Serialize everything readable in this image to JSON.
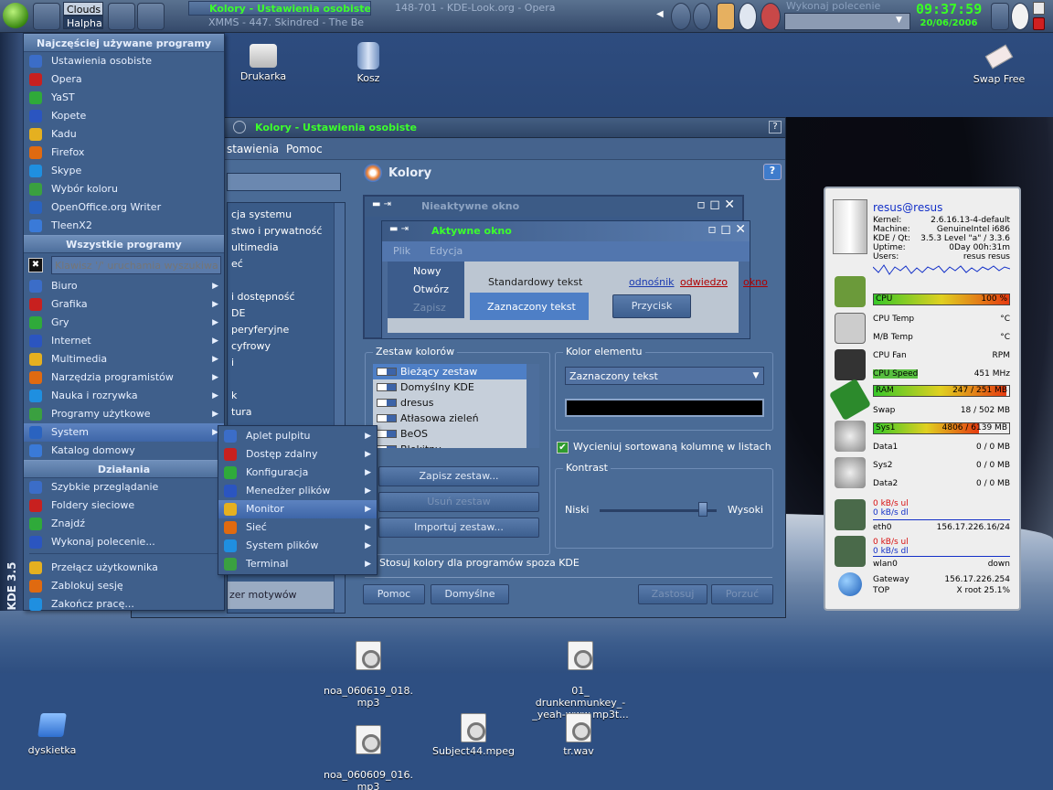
{
  "taskbar": {
    "desktops": [
      "Clouds",
      "Halpha"
    ],
    "tasks": [
      "Kolory - Ustawienia osobiste",
      "XMMS - 447. Skindred - The Be",
      "148-701 - KDE-Look.org - Opera"
    ],
    "run_label": "Wykonaj polecenie",
    "clock_time": "09:37:59",
    "clock_date": "20/06/2006"
  },
  "desktop": {
    "icons": [
      {
        "name": "printer-icon",
        "label": "Drukarka"
      },
      {
        "name": "trash-icon",
        "label": "Kosz"
      },
      {
        "name": "swap-icon",
        "label": "Swap Free"
      },
      {
        "name": "floppy-icon",
        "label": "dyskietka"
      },
      {
        "name": "mp3-icon",
        "label": "noa_060619_018.\nmp3"
      },
      {
        "name": "mp3-icon",
        "label": "01_\ndrunkenmunkey_-\n_yeah-www.mp3t..."
      },
      {
        "name": "mp3-icon",
        "label": "noa_060609_016.\nmp3"
      },
      {
        "name": "video-icon",
        "label": "Subject44.mpeg"
      },
      {
        "name": "wav-icon",
        "label": "tr.wav"
      }
    ]
  },
  "kmenu": {
    "vertical_label": "KDE 3.5",
    "sec_frequent": "Najczęściej używane programy",
    "frequent": [
      "Ustawienia osobiste",
      "Opera",
      "YaST",
      "Kopete",
      "Kadu",
      "Firefox",
      "Skype",
      "Wybór koloru",
      "OpenOffice.org Writer",
      "TleenX2"
    ],
    "sec_all": "Wszystkie programy",
    "search_placeholder": "Klawisz '/' uruchamia wyszukiwa",
    "all": [
      "Biuro",
      "Grafika",
      "Gry",
      "Internet",
      "Multimedia",
      "Narzędzia programistów",
      "Nauka i rozrywka",
      "Programy użytkowe",
      "System",
      "Katalog domowy"
    ],
    "sec_actions": "Działania",
    "actions": [
      "Szybkie przeglądanie",
      "Foldery sieciowe",
      "Znajdź",
      "Wykonaj polecenie...",
      "Przełącz użytkownika",
      "Zablokuj sesję",
      "Zakończ pracę..."
    ]
  },
  "submenu": [
    "Aplet pulpitu",
    "Dostęp zdalny",
    "Konfiguracja",
    "Menedżer plików",
    "Monitor",
    "Sieć",
    "System plików",
    "Terminal"
  ],
  "window": {
    "title": "Kolory - Ustawienia osobiste",
    "menu": [
      "stawienia",
      "Pomoc"
    ],
    "help_btn": "?",
    "nav_items": [
      "cja systemu",
      "stwo i prywatność",
      "ultimedia",
      "eć",
      "",
      "i dostępność",
      "DE",
      "peryferyjne",
      "cyfrowy",
      "i",
      "",
      "k",
      "tura"
    ],
    "nav_bottom": "zer motywów",
    "header": "Kolory",
    "preview": {
      "inactive": "Nieaktywne okno",
      "active": "Aktywne okno",
      "menu_plik": "Plik",
      "menu_edycja": "Edycja",
      "popup": [
        "Nowy",
        "Otwórz",
        "Zapisz"
      ],
      "std_text": "Standardowy tekst",
      "sel_text": "Zaznaczony tekst",
      "link": "odnośnik",
      "visited": "odwiedzo",
      "window_word": "okno",
      "button": "Przycisk"
    },
    "scheme_group": "Zestaw kolorów",
    "schemes": [
      "Bieżący zestaw",
      "Domyślny KDE",
      "dresus",
      "Atłasowa zieleń",
      "BeOS",
      "Błękitny"
    ],
    "save_scheme": "Zapisz zestaw...",
    "remove_scheme": "Usuń zestaw",
    "import_scheme": "Importuj zestaw...",
    "widget_group": "Kolor elementu",
    "widget_value": "Zaznaczony tekst",
    "shade_label": "Wycieniuj sortowaną kolumnę w listach",
    "contrast_group": "Kontrast",
    "low": "Niski",
    "high": "Wysoki",
    "contrast_level": 0.88,
    "apply_nonkde": "Stosuj kolory dla programów spoza KDE",
    "btn_help": "Pomoc",
    "btn_defaults": "Domyślne",
    "btn_apply": "Zastosuj",
    "btn_reset": "Porzuć"
  },
  "monitor": {
    "user": "resus@resus",
    "info": [
      [
        "Kernel:",
        "2.6.16.13-4-default"
      ],
      [
        "Machine:",
        "GenuineIntel    i686"
      ],
      [
        "KDE / Qt:",
        "3.5.3 Level \"a\"  /  3.3.6"
      ],
      [
        "Uptime:",
        "0Day   00h:31m"
      ],
      [
        "Users:",
        "resus resus"
      ]
    ],
    "cpu_label": "CPU",
    "cpu_value": "100 %",
    "cpu_frac": 1.0,
    "cputemp_label": "CPU Temp",
    "cputemp_unit": "°C",
    "mbtemp_label": "M/B Temp",
    "mbtemp_unit": "°C",
    "fan_label": "CPU Fan",
    "fan_unit": "RPM",
    "speed_label": "CPU Speed",
    "speed_value": "451 MHz",
    "ram_label": "RAM",
    "ram_value": "247 / 251 MB",
    "ram_frac": 0.98,
    "swap_label": "Swap",
    "swap_value": "18 / 502 MB",
    "sys1_label": "Sys1",
    "sys1_value": "4806 / 6139 MB",
    "sys1_frac": 0.78,
    "data1_label": "Data1",
    "data1_value": "0 / 0 MB",
    "sys2_label": "Sys2",
    "sys2_value": "0 / 0 MB",
    "data2_label": "Data2",
    "data2_value": "0 / 0 MB",
    "eth_ul": "0 kB/s ul",
    "eth_dl": "0 kB/s dl",
    "eth_name": "eth0",
    "eth_ip": "156.17.226.16/24",
    "wlan_ul": "0 kB/s ul",
    "wlan_dl": "0 kB/s dl",
    "wlan_name": "wlan0",
    "wlan_state": "down",
    "gw_label": "Gateway",
    "gw_value": "156.17.226.254",
    "top_label": "TOP",
    "top_value": "X root 25.1%"
  },
  "colors": {
    "accent": "#3cff2c",
    "menu_bg": "#3f5f8b",
    "selection": "#4e7fc6"
  }
}
